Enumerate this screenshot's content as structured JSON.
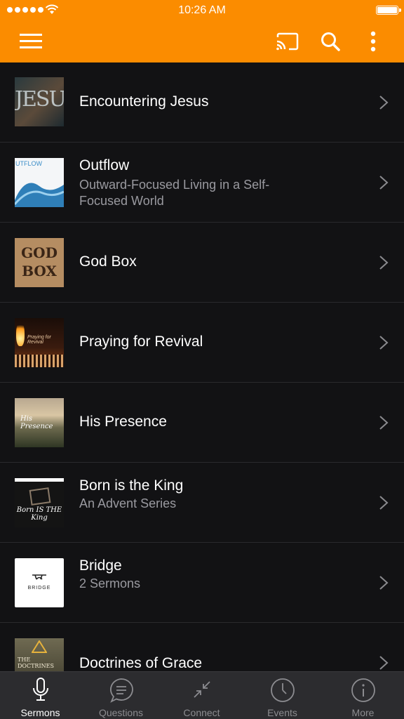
{
  "status": {
    "time": "10:26 AM"
  },
  "header": {
    "icons": [
      "menu-icon",
      "cast-icon",
      "search-icon",
      "more-vert-icon"
    ],
    "color": "#fb8c00"
  },
  "series": [
    {
      "title": "Encountering Jesus",
      "subtitle": "",
      "thumb_text": "JESUS"
    },
    {
      "title": "Outflow",
      "subtitle": "Outward-Focused Living in a Self-Focused World",
      "thumb_text": "UTFLOW"
    },
    {
      "title": "God Box",
      "subtitle": "",
      "thumb_text": "GOD BOX"
    },
    {
      "title": "Praying for Revival",
      "subtitle": "",
      "thumb_text": "Praying for Revival"
    },
    {
      "title": "His Presence",
      "subtitle": "",
      "thumb_text": "His Presence"
    },
    {
      "title": "Born is the King",
      "subtitle": "An  Advent Series",
      "thumb_text": "Born IS THE King"
    },
    {
      "title": "Bridge",
      "subtitle": "2 Sermons",
      "thumb_text": "BRIDGE"
    },
    {
      "title": "Doctrines of Grace",
      "subtitle": "",
      "thumb_text": "THE DOCTRINES"
    }
  ],
  "tabs": [
    {
      "label": "Sermons",
      "icon": "microphone-icon",
      "active": true
    },
    {
      "label": "Questions",
      "icon": "chat-bubble-icon",
      "active": false
    },
    {
      "label": "Connect",
      "icon": "connect-arrows-icon",
      "active": false
    },
    {
      "label": "Events",
      "icon": "clock-icon",
      "active": false
    },
    {
      "label": "More",
      "icon": "info-icon",
      "active": false
    }
  ]
}
